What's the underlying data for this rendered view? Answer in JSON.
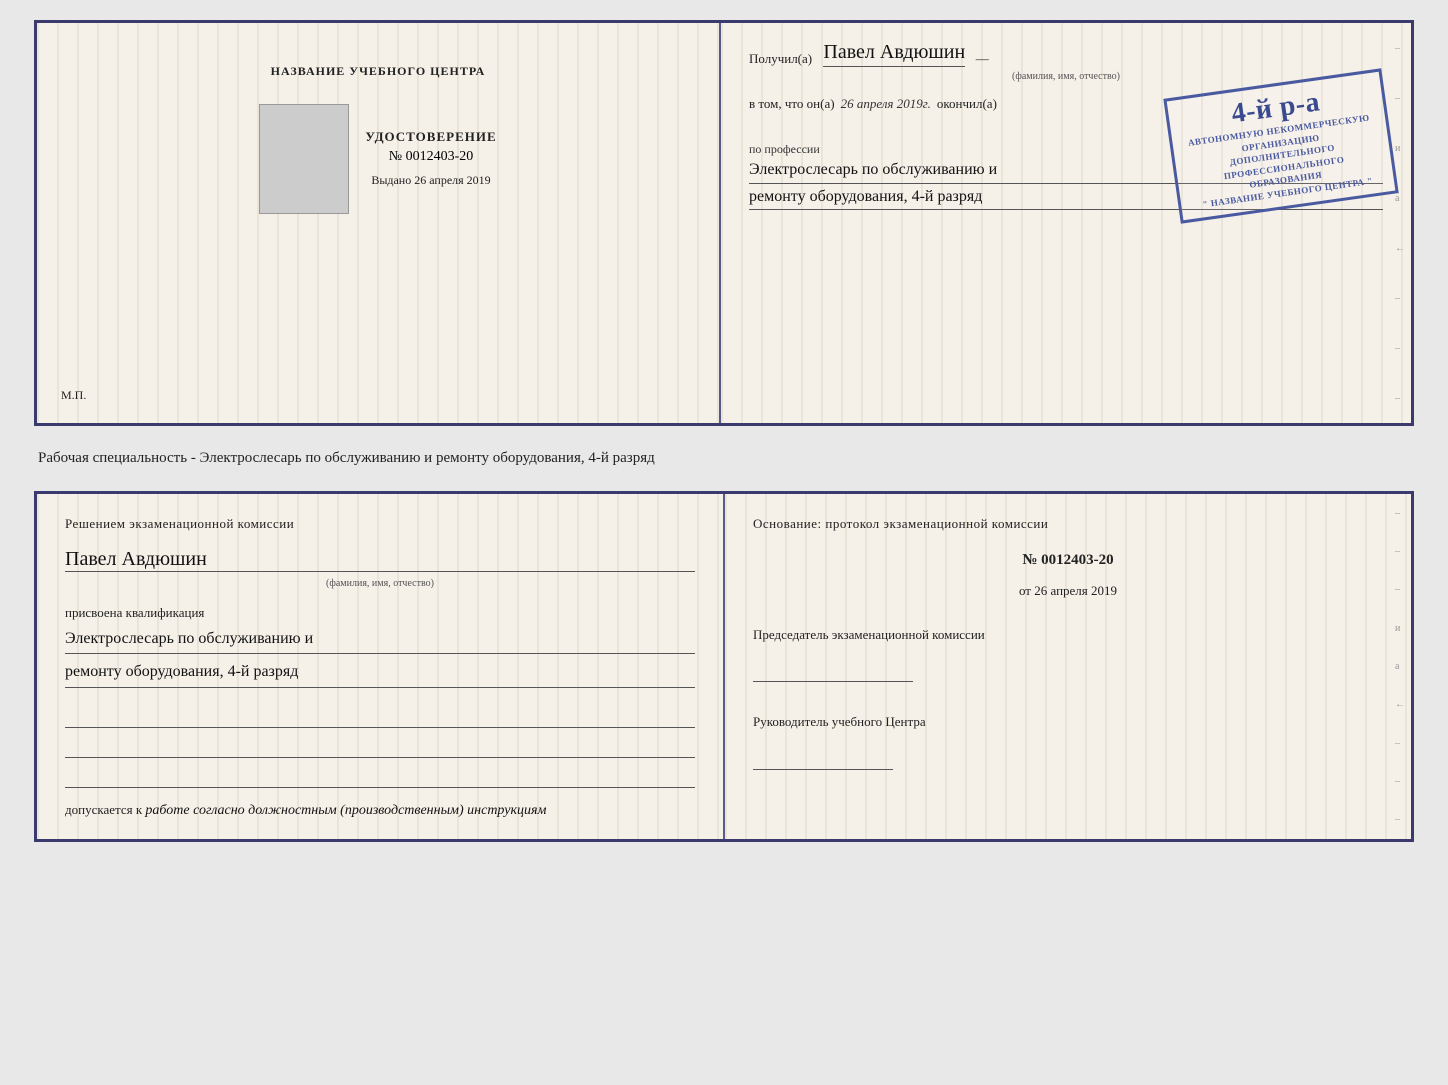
{
  "top": {
    "left": {
      "title": "НАЗВАНИЕ УЧЕБНОГО ЦЕНТРА",
      "udostoverenie_label": "УДОСТОВЕРЕНИЕ",
      "number": "№ 0012403-20",
      "vydano_label": "Выдано",
      "vydano_date": "26 апреля 2019",
      "mp": "М.П."
    },
    "right": {
      "poluchil_label": "Получил(а)",
      "name": "Павел Авдюшин",
      "name_hint": "(фамилия, имя, отчество)",
      "vtom_prefix": "в том, что он(а)",
      "date_italic": "26 апреля 2019г.",
      "okonchil_label": "окончил(а)",
      "stamp_line1": "АВТОНОМНУЮ НЕКОММЕРЧЕСКУЮ ОРГАНИЗАЦИЮ",
      "stamp_line2": "ДОПОЛНИТЕЛЬНОГО ПРОФЕССИОНАЛЬНОГО ОБРАЗОВАНИЯ",
      "stamp_line3": "\" НАЗВАНИЕ УЧЕБНОГО ЦЕНТРА \"",
      "stamp_big": "4-й р-а",
      "po_professii": "по профессии",
      "profession_line1": "Электрослесарь по обслуживанию и",
      "profession_line2": "ремонту оборудования, 4-й разряд"
    }
  },
  "description": "Рабочая специальность - Электрослесарь по обслуживанию и ремонту оборудования, 4-й разряд",
  "bottom": {
    "left": {
      "resheniem_label": "Решением экзаменационной  комиссии",
      "name": "Павел Авдюшин",
      "name_hint": "(фамилия, имя, отчество)",
      "prisvoena_label": "присвоена квалификация",
      "qualification_line1": "Электрослесарь по обслуживанию и",
      "qualification_line2": "ремонту оборудования, 4-й разряд",
      "dopuskaetsya_prefix": "допускается к",
      "dopuskaetsya_italic": "работе согласно должностным (производственным) инструкциям"
    },
    "right": {
      "osnovanie_label": "Основание: протокол экзаменационной  комиссии",
      "protocol_number": "№  0012403-20",
      "ot_label": "от",
      "ot_date": "26 апреля 2019",
      "predsedatel_label": "Председатель экзаменационной комиссии",
      "rukovoditel_label": "Руководитель учебного Центра"
    }
  },
  "side_chars": [
    "-",
    "-",
    "-",
    "и",
    "а",
    "←",
    "-",
    "-",
    "-"
  ]
}
